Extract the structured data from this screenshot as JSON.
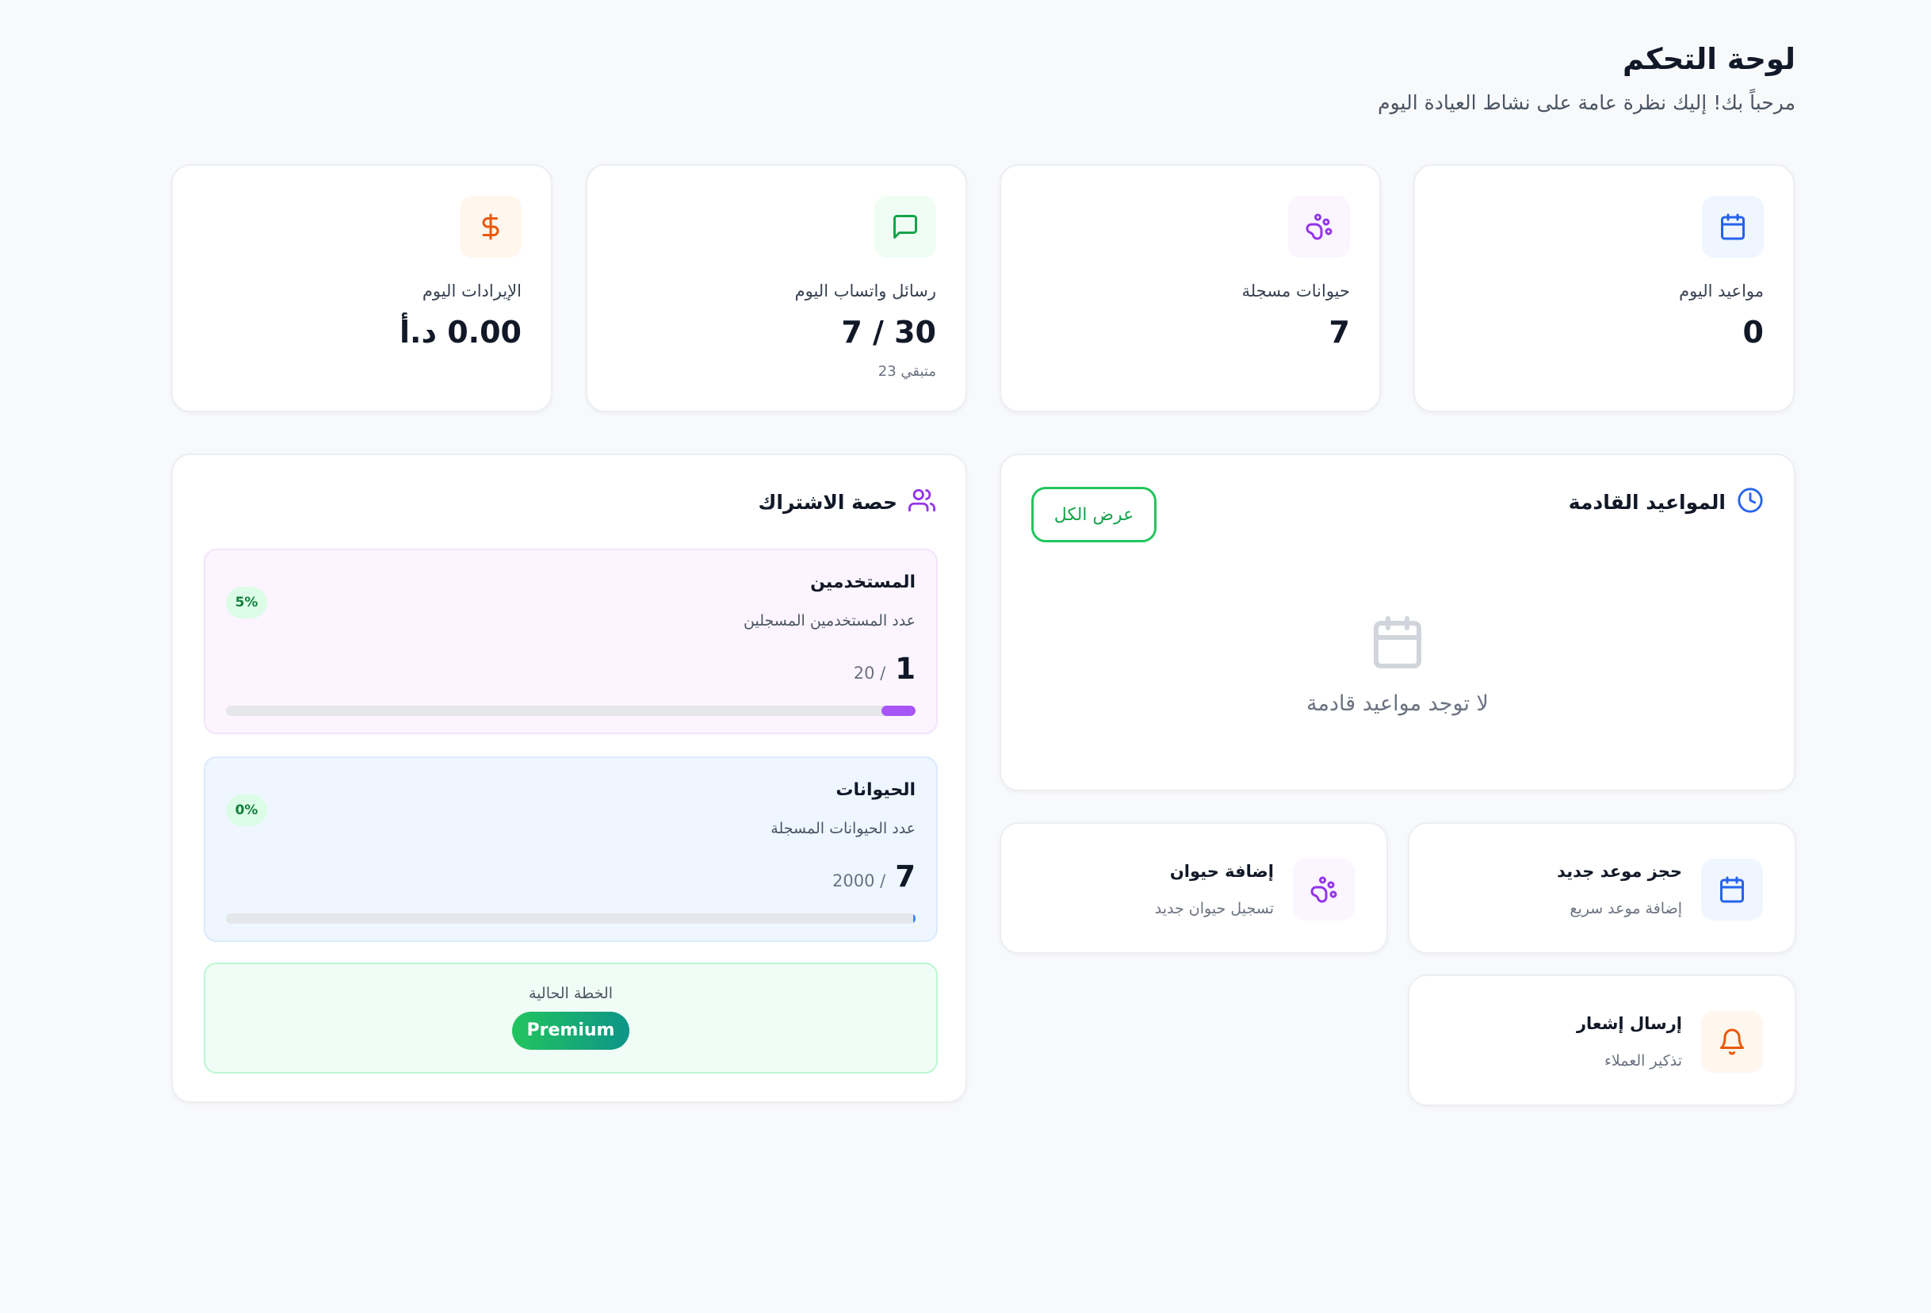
{
  "header": {
    "title": "لوحة التحكم",
    "subtitle": "مرحباً بك! إليك نظرة عامة على نشاط العيادة اليوم"
  },
  "stats": [
    {
      "label": "مواعيد اليوم",
      "value": "0",
      "sub": "",
      "icon": "calendar-icon",
      "color": "#2563eb",
      "bg": "#eff6ff"
    },
    {
      "label": "حيوانات مسجلة",
      "value": "7",
      "sub": "",
      "icon": "paw-icon",
      "color": "#9333ea",
      "bg": "#faf5ff"
    },
    {
      "label": "رسائل واتساب اليوم",
      "value": "7 / 30",
      "sub": "متبقي 23",
      "icon": "message-icon",
      "color": "#16a34a",
      "bg": "#f0fdf4"
    },
    {
      "label": "الإيرادات اليوم",
      "value": "0.00 د.أ",
      "sub": "",
      "icon": "dollar-icon",
      "color": "#ea580c",
      "bg": "#fff7ed"
    }
  ],
  "upcoming": {
    "title": "المواعيد القادمة",
    "view_all": "عرض الكل",
    "empty_text": "لا توجد مواعيد قادمة",
    "accent": "#2563eb"
  },
  "actions": [
    {
      "title": "حجز موعد جديد",
      "sub": "إضافة موعد سريع",
      "icon": "calendar-icon",
      "color": "#2563eb",
      "bg": "#eff6ff"
    },
    {
      "title": "إضافة حيوان",
      "sub": "تسجيل حيوان جديد",
      "icon": "paw-icon",
      "color": "#9333ea",
      "bg": "#faf5ff"
    },
    {
      "title": "إرسال إشعار",
      "sub": "تذكير العملاء",
      "icon": "bell-icon",
      "color": "#ea580c",
      "bg": "#fff7ed"
    }
  ],
  "subscription": {
    "title": "حصة الاشتراك",
    "quotas": [
      {
        "title": "المستخدمين",
        "desc": "عدد المستخدمين المسجلين",
        "used": "1",
        "limit": "/ 20",
        "percent_label": "5%",
        "percent": 5,
        "color": "#a855f7",
        "bg": "#fcf5ff",
        "border": "#f3e3fc"
      },
      {
        "title": "الحيوانات",
        "desc": "عدد الحيوانات المسجلة",
        "used": "7",
        "limit": "/ 2000",
        "percent_label": "0%",
        "percent": 0.35,
        "color": "#3b82f6",
        "bg": "#eff6ff",
        "border": "#dbeafe"
      }
    ],
    "plan_label": "الخطة الحالية",
    "plan_name": "Premium"
  }
}
